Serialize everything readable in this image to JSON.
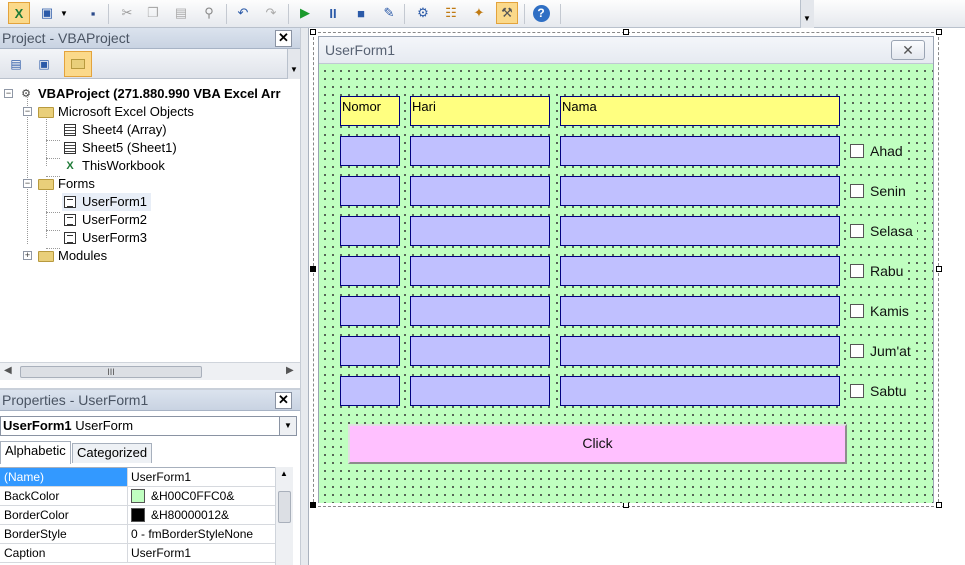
{
  "toolbar": {
    "buttons": [
      "excel-icon",
      "view-object-icon",
      "insert-userform-icon",
      "save-icon",
      "cut-icon",
      "copy-icon",
      "paste-icon",
      "find-icon",
      "undo-icon",
      "redo-icon",
      "run-icon",
      "break-icon",
      "reset-icon",
      "design-mode-icon",
      "project-explorer-icon",
      "properties-icon",
      "object-browser-icon",
      "toolbox-icon",
      "help-icon"
    ]
  },
  "project": {
    "title": "Project - VBAProject",
    "close": "✕",
    "tree": {
      "root": "VBAProject (271.880.990 VBA Excel Arr",
      "excel_objects": "Microsoft Excel Objects",
      "sheet4": "Sheet4 (Array)",
      "sheet5": "Sheet5 (Sheet1)",
      "thisworkbook": "ThisWorkbook",
      "forms": "Forms",
      "userform1": "UserForm1",
      "userform2": "UserForm2",
      "userform3": "UserForm3",
      "modules": "Modules"
    },
    "scroll_grip": "III"
  },
  "properties": {
    "title": "Properties - UserForm1",
    "close": "✕",
    "combo_name": "UserForm1",
    "combo_type": "UserForm",
    "tabs": [
      "Alphabetic",
      "Categorized"
    ],
    "rows": [
      {
        "key": "(Name)",
        "value": "UserForm1",
        "swatch": null
      },
      {
        "key": "BackColor",
        "value": "&H00C0FFC0&",
        "swatch": "#c0ffc0"
      },
      {
        "key": "BorderColor",
        "value": "&H80000012&",
        "swatch": "#000000"
      },
      {
        "key": "BorderStyle",
        "value": "0 - fmBorderStyleNone",
        "swatch": null
      },
      {
        "key": "Caption",
        "value": "UserForm1",
        "swatch": null
      }
    ]
  },
  "userform": {
    "title": "UserForm1",
    "close": "✕",
    "headers": [
      "Nomor",
      "Hari",
      "Nama"
    ],
    "days": [
      "Ahad",
      "Senin",
      "Selasa",
      "Rabu",
      "Kamis",
      "Jum'at",
      "Sabtu"
    ],
    "button_label": "Click"
  },
  "colors": {
    "form_back": "#c0ffc0",
    "header_back": "#ffff80",
    "cell_back": "#c0c0ff",
    "button_back": "#ffc0ff"
  }
}
